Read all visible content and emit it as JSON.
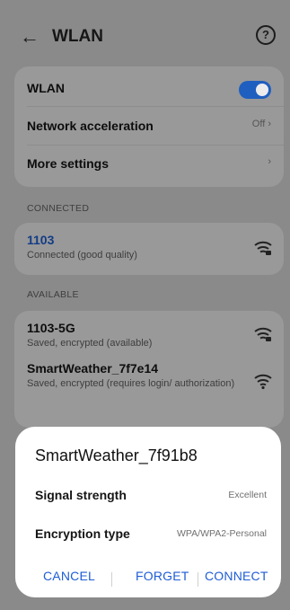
{
  "header": {
    "title": "WLAN",
    "back_icon": "arrow-left-icon",
    "help_icon": "help-circle-icon"
  },
  "settings": {
    "wlan_label": "WLAN",
    "wlan_enabled": true,
    "network_acceleration_label": "Network acceleration",
    "network_acceleration_value": "Off",
    "more_settings_label": "More settings"
  },
  "connected": {
    "section_label": "CONNECTED",
    "ssid": "1103",
    "status": "Connected (good quality)"
  },
  "available": {
    "section_label": "AVAILABLE",
    "networks": [
      {
        "ssid": "1103-5G",
        "status": "Saved, encrypted (available)"
      },
      {
        "ssid": "SmartWeather_7f7e14",
        "status": "Saved, encrypted (requires login/ authorization)"
      }
    ]
  },
  "dialog": {
    "title": "SmartWeather_7f91b8",
    "signal_label": "Signal strength",
    "signal_value": "Excellent",
    "encryption_label": "Encryption type",
    "encryption_value": "WPA/WPA2-Personal",
    "cancel_label": "CANCEL",
    "forget_label": "FORGET",
    "connect_label": "CONNECT"
  },
  "colors": {
    "accent": "#1e5dd6",
    "toggle_on": "#1f5fbf",
    "scrim": "#8a8a8a"
  }
}
